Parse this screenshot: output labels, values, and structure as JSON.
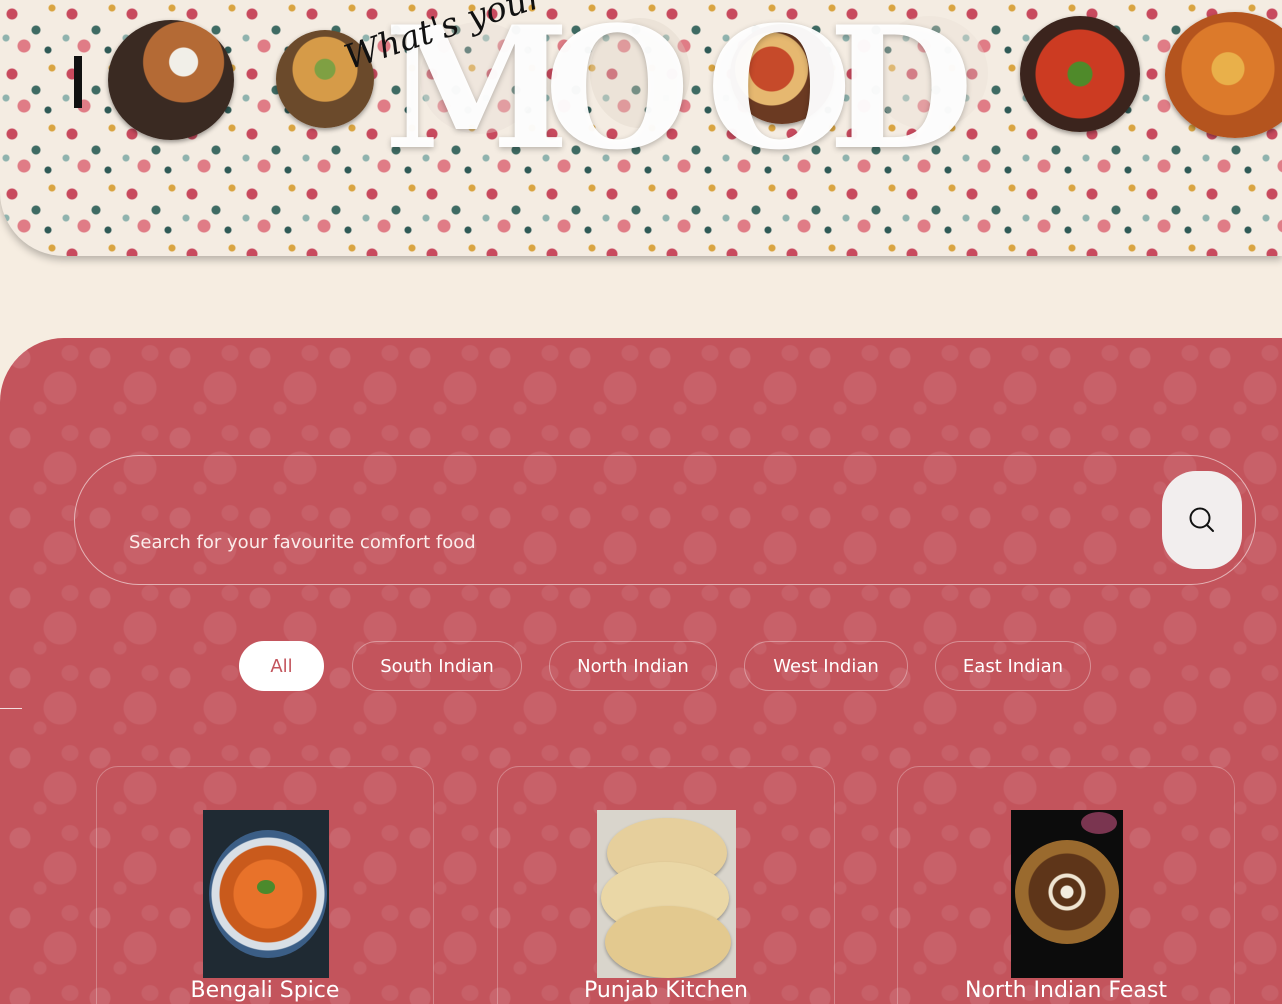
{
  "hero": {
    "title": "MOOD",
    "tagline": "What's your",
    "dishes": [
      {
        "name": "vada-dish-icon",
        "colors": [
          "#3a2a22",
          "#b46a35",
          "#f1efe8"
        ]
      },
      {
        "name": "snack-platter-icon",
        "colors": [
          "#6b4a2b",
          "#d69b48",
          "#7fa043"
        ]
      },
      {
        "name": "curry-bowl-faded-icon",
        "colors": [
          "#d8cfc3",
          "#e5ddd3",
          "#f0e8de"
        ]
      },
      {
        "name": "pav-bhaji-dish-icon",
        "colors": [
          "#6b3a22",
          "#c64a2a",
          "#e6b870"
        ]
      },
      {
        "name": "roti-dish-faded-icon",
        "colors": [
          "#d9cfc2",
          "#e8dfd4",
          "#efe7dc"
        ]
      },
      {
        "name": "okra-curry-dish-icon",
        "colors": [
          "#3b241d",
          "#cc3b22",
          "#4f8a2a"
        ]
      },
      {
        "name": "fish-curry-dish-icon",
        "colors": [
          "#b4541e",
          "#dc7a2b",
          "#e9b04a"
        ]
      }
    ]
  },
  "search": {
    "placeholder": "Search for your favourite comfort food",
    "button_icon": "search-icon"
  },
  "filters": [
    {
      "label": "All",
      "active": true
    },
    {
      "label": "South Indian",
      "active": false
    },
    {
      "label": "North Indian",
      "active": false
    },
    {
      "label": "West Indian",
      "active": false
    },
    {
      "label": "East Indian",
      "active": false
    }
  ],
  "cards": [
    {
      "title": "Bengali Spice",
      "image": "prawn-curry-image"
    },
    {
      "title": "Punjab Kitchen",
      "image": "paratha-image"
    },
    {
      "title": "North Indian Feast",
      "image": "dal-makhani-image"
    }
  ],
  "colors": {
    "panel": "#c3545c",
    "page_bg": "#f6ede1",
    "chip_active_bg": "#ffffff",
    "chip_active_text": "#c3545c"
  }
}
